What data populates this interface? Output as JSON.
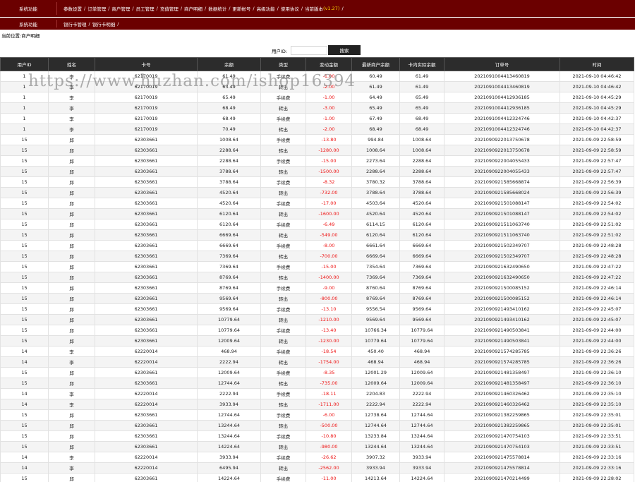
{
  "nav": {
    "section1": "系统功能",
    "menu1": [
      "参数设置",
      "订单管理",
      "商户管理",
      "员工管理",
      "充值管理",
      "商户明细",
      "数据统计",
      "更新帐号",
      "高级功能",
      "使用协议",
      "当前版本"
    ],
    "version": "(v1.27)",
    "section2": "系统功能",
    "menu2": [
      "银行卡管理",
      "银行卡明细"
    ]
  },
  "breadcrumb": "当前位置:商户明细",
  "search": {
    "label": "用户ID:",
    "placeholder": "",
    "button": "搜索"
  },
  "watermark": "https://www.huzhan.com/ishop16394",
  "table": {
    "columns": [
      "用户ID",
      "姓名",
      "卡号",
      "余额",
      "类型",
      "变动金额",
      "最新商户余额",
      "卡内实际余额",
      "订单号",
      "时间"
    ],
    "rows": [
      [
        "1",
        "李",
        "62170019",
        "61.49",
        "手续费",
        "-1.00",
        "60.49",
        "61.49",
        "2021091004413460819",
        "2021-09-10 04:46:42"
      ],
      [
        "1",
        "李",
        "62170019",
        "63.49",
        "转出",
        "-2.00",
        "61.49",
        "61.49",
        "2021091004413460819",
        "2021-09-10 04:46:42"
      ],
      [
        "1",
        "李",
        "62170019",
        "65.49",
        "手续费",
        "-1.00",
        "64.49",
        "65.49",
        "2021091004412936185",
        "2021-09-10 04:45:29"
      ],
      [
        "1",
        "李",
        "62170019",
        "68.49",
        "转出",
        "-3.00",
        "65.49",
        "65.49",
        "2021091004412936185",
        "2021-09-10 04:45:29"
      ],
      [
        "1",
        "李",
        "62170019",
        "68.49",
        "手续费",
        "-1.00",
        "67.49",
        "68.49",
        "2021091004412324746",
        "2021-09-10 04:42:37"
      ],
      [
        "1",
        "李",
        "62170019",
        "70.49",
        "转出",
        "-2.00",
        "68.49",
        "68.49",
        "2021091004412324746",
        "2021-09-10 04:42:37"
      ],
      [
        "15",
        "邱",
        "62303661",
        "1008.64",
        "手续费",
        "-13.80",
        "994.84",
        "1008.64",
        "2021090922013750678",
        "2021-09-09 22:58:59"
      ],
      [
        "15",
        "邱",
        "62303661",
        "2288.64",
        "转出",
        "-1280.00",
        "1008.64",
        "1008.64",
        "2021090922013750678",
        "2021-09-09 22:58:59"
      ],
      [
        "15",
        "邱",
        "62303661",
        "2288.64",
        "手续费",
        "-15.00",
        "2273.64",
        "2288.64",
        "2021090922004055433",
        "2021-09-09 22:57:47"
      ],
      [
        "15",
        "邱",
        "62303661",
        "3788.64",
        "转出",
        "-1500.00",
        "2288.64",
        "2288.64",
        "2021090922004055433",
        "2021-09-09 22:57:47"
      ],
      [
        "15",
        "邱",
        "62303661",
        "3788.64",
        "手续费",
        "-8.32",
        "3780.32",
        "3788.64",
        "2021090921585668874",
        "2021-09-09 22:56:39"
      ],
      [
        "15",
        "邱",
        "62303661",
        "4520.64",
        "转出",
        "-732.00",
        "3788.64",
        "3788.64",
        "2021090921585668024",
        "2021-09-09 22:56:39"
      ],
      [
        "15",
        "邱",
        "62303661",
        "4520.64",
        "手续费",
        "-17.00",
        "4503.64",
        "4520.64",
        "2021090921501088147",
        "2021-09-09 22:54:02"
      ],
      [
        "15",
        "邱",
        "62303661",
        "6120.64",
        "转出",
        "-1600.00",
        "4520.64",
        "4520.64",
        "2021090921501088147",
        "2021-09-09 22:54:02"
      ],
      [
        "15",
        "邱",
        "62303661",
        "6120.64",
        "手续费",
        "-6.49",
        "6114.15",
        "6120.64",
        "2021090921511063740",
        "2021-09-09 22:51:02"
      ],
      [
        "15",
        "邱",
        "62303661",
        "6669.64",
        "转出",
        "-549.00",
        "6120.64",
        "6120.64",
        "2021090921511063740",
        "2021-09-09 22:51:02"
      ],
      [
        "15",
        "邱",
        "62303661",
        "6669.64",
        "手续费",
        "-8.00",
        "6661.64",
        "6669.64",
        "2021090921502349707",
        "2021-09-09 22:48:28"
      ],
      [
        "15",
        "邱",
        "62303661",
        "7369.64",
        "转出",
        "-700.00",
        "6669.64",
        "6669.64",
        "2021090921502349707",
        "2021-09-09 22:48:28"
      ],
      [
        "15",
        "邱",
        "62303661",
        "7369.64",
        "手续费",
        "-15.00",
        "7354.64",
        "7369.64",
        "2021090921632490650",
        "2021-09-09 22:47:22"
      ],
      [
        "15",
        "邱",
        "62303661",
        "8769.64",
        "转出",
        "-1400.00",
        "7369.64",
        "7369.64",
        "2021090921632490650",
        "2021-09-09 22:47:22"
      ],
      [
        "15",
        "邱",
        "62303661",
        "8769.64",
        "手续费",
        "-9.00",
        "8760.64",
        "8769.64",
        "2021090921500085152",
        "2021-09-09 22:46:14"
      ],
      [
        "15",
        "邱",
        "62303661",
        "9569.64",
        "转出",
        "-800.00",
        "8769.64",
        "8769.64",
        "2021090921500085152",
        "2021-09-09 22:46:14"
      ],
      [
        "15",
        "邱",
        "62303661",
        "9569.64",
        "手续费",
        "-13.10",
        "9556.54",
        "9569.64",
        "2021090921493410162",
        "2021-09-09 22:45:07"
      ],
      [
        "15",
        "邱",
        "62303661",
        "10779.64",
        "转出",
        "-1210.00",
        "9569.64",
        "9569.64",
        "2021090921493410162",
        "2021-09-09 22:45:07"
      ],
      [
        "15",
        "邱",
        "62303661",
        "10779.64",
        "手续费",
        "-13.40",
        "10766.34",
        "10779.64",
        "2021090921490503841",
        "2021-09-09 22:44:00"
      ],
      [
        "15",
        "邱",
        "62303661",
        "12009.64",
        "转出",
        "-1230.00",
        "10779.64",
        "10779.64",
        "2021090921490503841",
        "2021-09-09 22:44:00"
      ],
      [
        "14",
        "李",
        "62220014",
        "468.94",
        "手续费",
        "-18.54",
        "450.40",
        "468.94",
        "2021090921574285785",
        "2021-09-09 22:36:26"
      ],
      [
        "14",
        "李",
        "62220014",
        "2222.94",
        "转出",
        "-1754.00",
        "468.94",
        "468.94",
        "2021090921574285785",
        "2021-09-09 22:36:26"
      ],
      [
        "15",
        "邱",
        "62303661",
        "12009.64",
        "手续费",
        "-8.35",
        "12001.29",
        "12009.64",
        "2021090921481358497",
        "2021-09-09 22:36:10"
      ],
      [
        "15",
        "邱",
        "62303661",
        "12744.64",
        "转出",
        "-735.00",
        "12009.64",
        "12009.64",
        "2021090921481358497",
        "2021-09-09 22:36:10"
      ],
      [
        "14",
        "李",
        "62220014",
        "2222.94",
        "手续费",
        "-18.11",
        "2204.83",
        "2222.94",
        "2021090921460326462",
        "2021-09-09 22:35:10"
      ],
      [
        "14",
        "李",
        "62220014",
        "3933.94",
        "转出",
        "-1711.00",
        "2222.94",
        "2222.94",
        "2021090921460326462",
        "2021-09-09 22:35:10"
      ],
      [
        "15",
        "邱",
        "62303661",
        "12744.64",
        "手续费",
        "-6.00",
        "12738.64",
        "12744.64",
        "2021090921382259865",
        "2021-09-09 22:35:01"
      ],
      [
        "15",
        "邱",
        "62303661",
        "13244.64",
        "转出",
        "-500.00",
        "12744.64",
        "12744.64",
        "2021090921382259865",
        "2021-09-09 22:35:01"
      ],
      [
        "15",
        "邱",
        "62303661",
        "13244.64",
        "手续费",
        "-10.80",
        "13233.84",
        "13244.64",
        "2021090921470754103",
        "2021-09-09 22:33:51"
      ],
      [
        "15",
        "邱",
        "62303661",
        "14224.64",
        "转出",
        "-980.00",
        "13244.64",
        "13244.64",
        "2021090921470754103",
        "2021-09-09 22:33:51"
      ],
      [
        "14",
        "李",
        "62220014",
        "3933.94",
        "手续费",
        "-26.62",
        "3907.32",
        "3933.94",
        "2021090921475578814",
        "2021-09-09 22:33:16"
      ],
      [
        "14",
        "李",
        "62220014",
        "6495.94",
        "转出",
        "-2562.00",
        "3933.94",
        "3933.94",
        "2021090921475578814",
        "2021-09-09 22:33:16"
      ],
      [
        "15",
        "邱",
        "62303661",
        "14224.64",
        "手续费",
        "-11.00",
        "14213.64",
        "14224.64",
        "2021090921470214499",
        "2021-09-09 22:28:02"
      ]
    ]
  },
  "colors": {
    "nav_bg": "#6b0000",
    "header_bg": "#2c2c2c",
    "negative": "#ee1111",
    "version": "#ffd400"
  }
}
